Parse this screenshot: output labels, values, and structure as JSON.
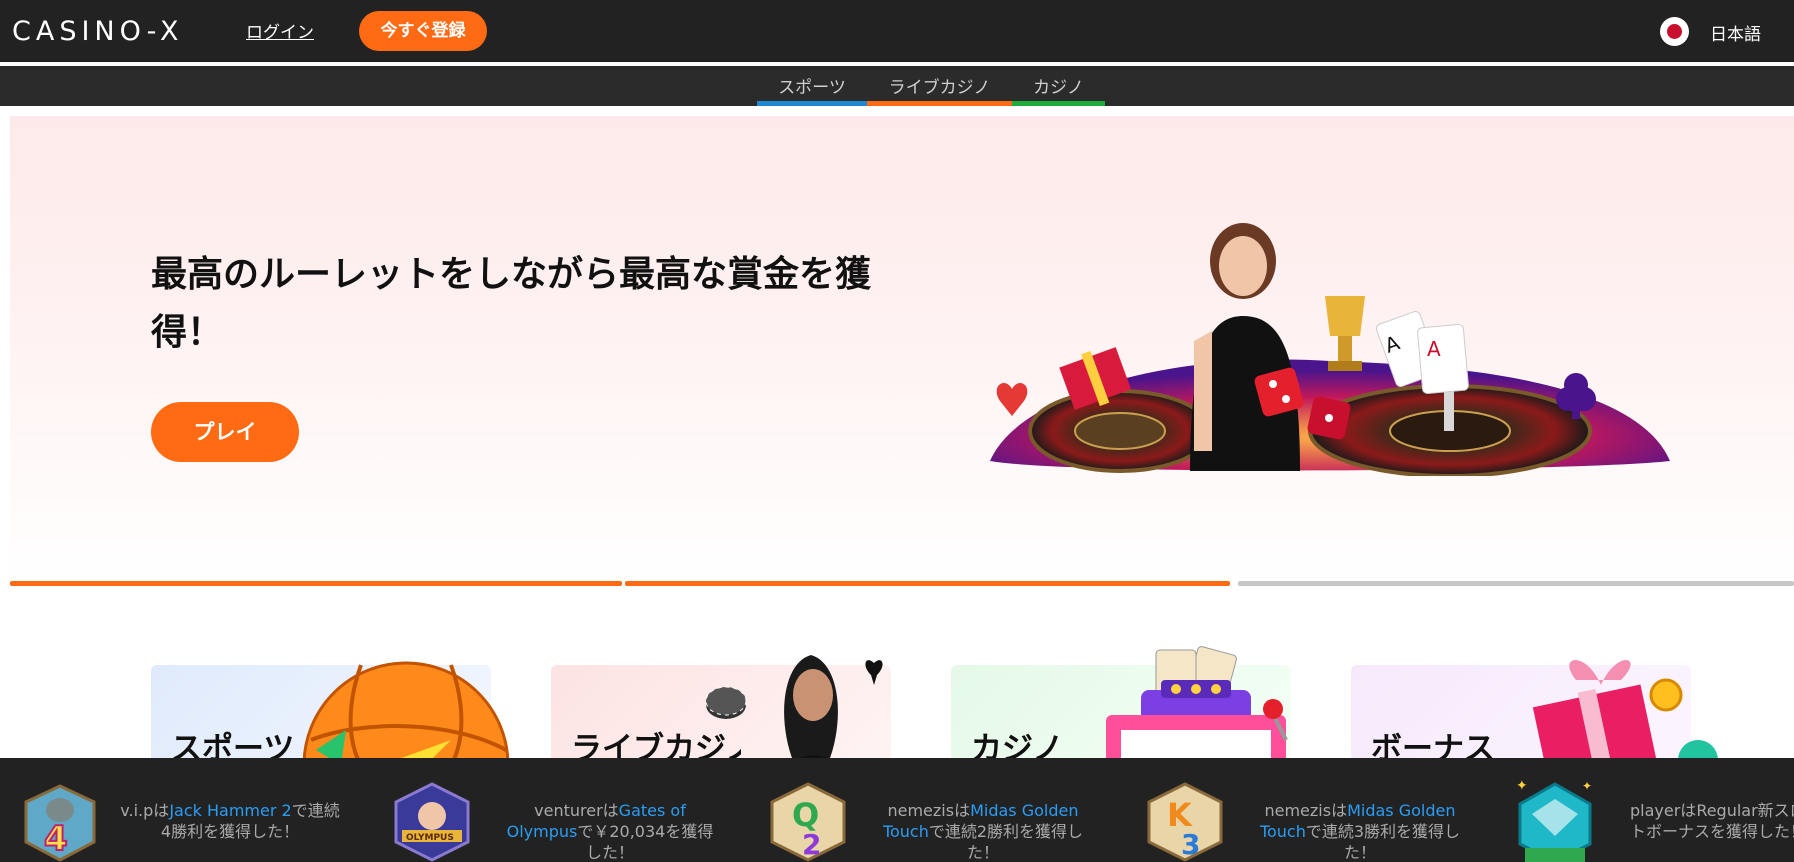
{
  "header": {
    "logo": "CASINO-X",
    "login_label": "ログイン",
    "register_label": "今すぐ登録",
    "language_label": "日本語",
    "language_flag_color": "#c8102e"
  },
  "subnav": {
    "tabs": [
      {
        "label": "スポーツ",
        "accent": "#1e88d2"
      },
      {
        "label": "ライブカジノ",
        "accent": "#ff6a13"
      },
      {
        "label": "カジノ",
        "accent": "#1faa3c"
      }
    ]
  },
  "hero": {
    "title": "最高のルーレットをしながら最高な賞金を獲得！",
    "play_label": "プレイ",
    "slides_total": 3,
    "slides_progress": [
      1,
      1,
      0
    ],
    "accent": "#ff6a13"
  },
  "categories": [
    {
      "label": "スポーツ",
      "icon": "basketball-icon"
    },
    {
      "label": "ライブカジノ",
      "icon": "live-dealer-icon"
    },
    {
      "label": "カジノ",
      "icon": "slot-machine-icon"
    },
    {
      "label": "ボーナス",
      "icon": "gift-icon"
    }
  ],
  "ticker": [
    {
      "user": "v.i.p",
      "pre": "は",
      "game": "Jack Hammer 2",
      "post": "で連続4勝利を獲得した！",
      "icon": "jack-hammer-4-icon"
    },
    {
      "user": "venturer",
      "pre": "は",
      "game": "Gates of Olympus",
      "post": "で￥20,034を獲得した！",
      "icon": "gates-of-olympus-icon"
    },
    {
      "user": "nemezis",
      "pre": "は",
      "game": "Midas Golden Touch",
      "post": "で連続2勝利を獲得した！",
      "icon": "midas-q2-icon"
    },
    {
      "user": "nemezis",
      "pre": "は",
      "game": "Midas Golden Touch",
      "post": "で連続3勝利を獲得した！",
      "icon": "midas-k3-icon"
    },
    {
      "user": "player",
      "pre": "は",
      "game": "",
      "post": "Regular新スロットボーナスを獲得した！",
      "icon": "diamond-badge-icon"
    }
  ]
}
